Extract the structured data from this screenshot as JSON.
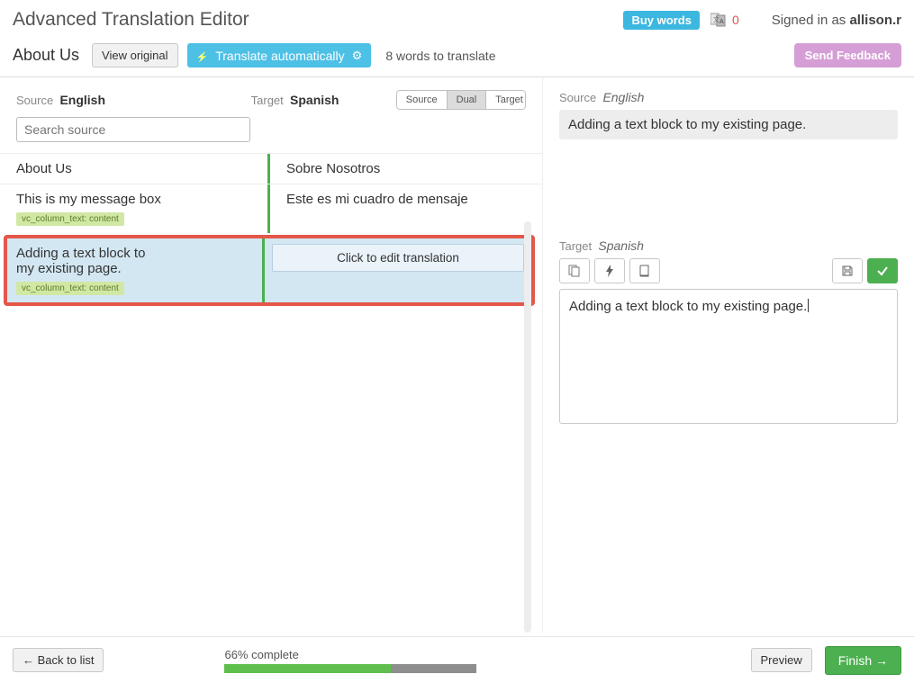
{
  "header": {
    "app_title": "Advanced Translation Editor",
    "buy_words": "Buy words",
    "doc_count": "0",
    "signed_in_prefix": "Signed in as ",
    "signed_in_user": "allison.r"
  },
  "subheader": {
    "doc_title": "About Us",
    "view_original": "View original",
    "translate_auto": "Translate automatically",
    "words_info": "8 words to translate",
    "send_feedback": "Send Feedback"
  },
  "columns": {
    "source_label": "Source",
    "source_lang": "English",
    "target_label": "Target",
    "target_lang": "Spanish",
    "search_placeholder": "Search source",
    "view_modes": {
      "source": "Source",
      "dual": "Dual",
      "target": "Target"
    }
  },
  "rows": [
    {
      "src": "About Us",
      "tgt": "Sobre Nosotros",
      "tag": ""
    },
    {
      "src": "This is my message box",
      "tgt": "Este es mi cuadro de mensaje",
      "tag": "vc_column_text: content"
    },
    {
      "src": "Adding a text block to my existing page.",
      "tgt": "Click to edit translation",
      "tag": "vc_column_text: content"
    }
  ],
  "right": {
    "source_label": "Source",
    "source_lang": "English",
    "source_text": "Adding a text block to my existing page.",
    "target_label": "Target",
    "target_lang": "Spanish",
    "editor_text": "Adding a text block to my existing page."
  },
  "footer": {
    "back": "← Back to list",
    "progress_label": "66% complete",
    "progress_pct": 66,
    "progress_dark_start": 66,
    "progress_dark_end": 100,
    "preview": "Preview",
    "finish": "Finish →"
  }
}
